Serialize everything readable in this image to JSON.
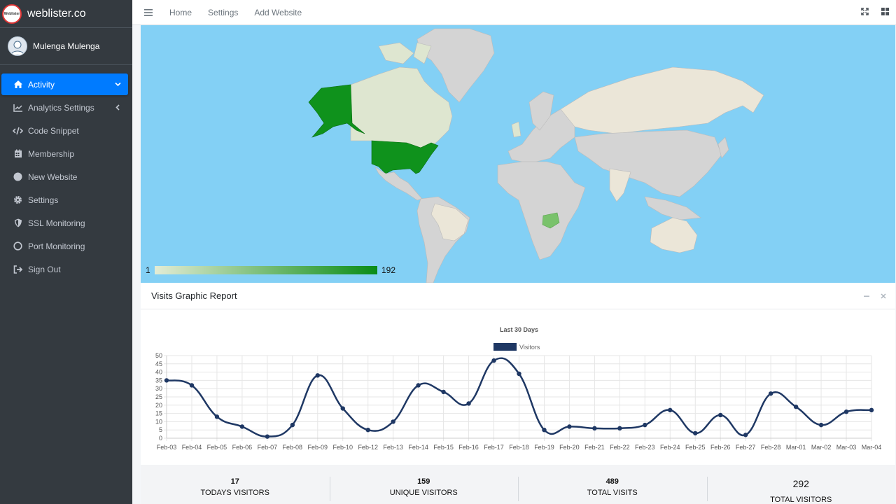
{
  "brand": {
    "name": "weblister.co",
    "logo_text": "Weblister"
  },
  "user": {
    "name": "Mulenga Mulenga"
  },
  "sidebar": {
    "items": [
      {
        "label": "Activity",
        "icon": "home-icon"
      },
      {
        "label": "Analytics Settings",
        "icon": "chart-line-icon"
      },
      {
        "label": "Code Snippet",
        "icon": "code-icon"
      },
      {
        "label": "Membership",
        "icon": "calendar-icon"
      },
      {
        "label": "New Website",
        "icon": "circle-icon"
      },
      {
        "label": "Settings",
        "icon": "gear-icon"
      },
      {
        "label": "SSL Monitoring",
        "icon": "shield-icon"
      },
      {
        "label": "Port Monitoring",
        "icon": "circle-outline-icon"
      },
      {
        "label": "Sign Out",
        "icon": "sign-out-icon"
      }
    ]
  },
  "topbar": {
    "links": [
      "Home",
      "Settings",
      "Add Website"
    ]
  },
  "map": {
    "legend_min": "1",
    "legend_max": "192",
    "colors": {
      "ocean": "#83d0f5",
      "land": "#d3d3d3",
      "low": "#e3ecd5",
      "high": "#0a8c16"
    }
  },
  "report": {
    "title": "Visits Graphic Report"
  },
  "chart_data": {
    "type": "line",
    "title": "Last 30 Days",
    "categories": [
      "Feb-03",
      "Feb-04",
      "Feb-05",
      "Feb-06",
      "Feb-07",
      "Feb-08",
      "Feb-09",
      "Feb-10",
      "Feb-12",
      "Feb-13",
      "Feb-14",
      "Feb-15",
      "Feb-16",
      "Feb-17",
      "Feb-18",
      "Feb-19",
      "Feb-20",
      "Feb-21",
      "Feb-22",
      "Feb-23",
      "Feb-24",
      "Feb-25",
      "Feb-26",
      "Feb-27",
      "Feb-28",
      "Mar-01",
      "Mar-02",
      "Mar-03",
      "Mar-04"
    ],
    "series": [
      {
        "name": "Visitors",
        "color": "#1f3864",
        "values": [
          35,
          32,
          13,
          7,
          1,
          8,
          38,
          18,
          5,
          10,
          32,
          28,
          21,
          47,
          39,
          5,
          7,
          6,
          6,
          8,
          17,
          3,
          14,
          2,
          27,
          19,
          8,
          16,
          17
        ]
      }
    ],
    "ylim": [
      0,
      50
    ],
    "yticks": [
      0,
      5,
      10,
      15,
      20,
      25,
      30,
      35,
      40,
      45,
      50
    ],
    "grid": true,
    "legend": "top-center"
  },
  "stats": [
    {
      "value": "17",
      "label": "TODAYS VISITORS"
    },
    {
      "value": "159",
      "label": "UNIQUE VISITORS"
    },
    {
      "value": "489",
      "label": "TOTAL VISITS"
    },
    {
      "value": "292",
      "label": "TOTAL VISITORS"
    }
  ]
}
